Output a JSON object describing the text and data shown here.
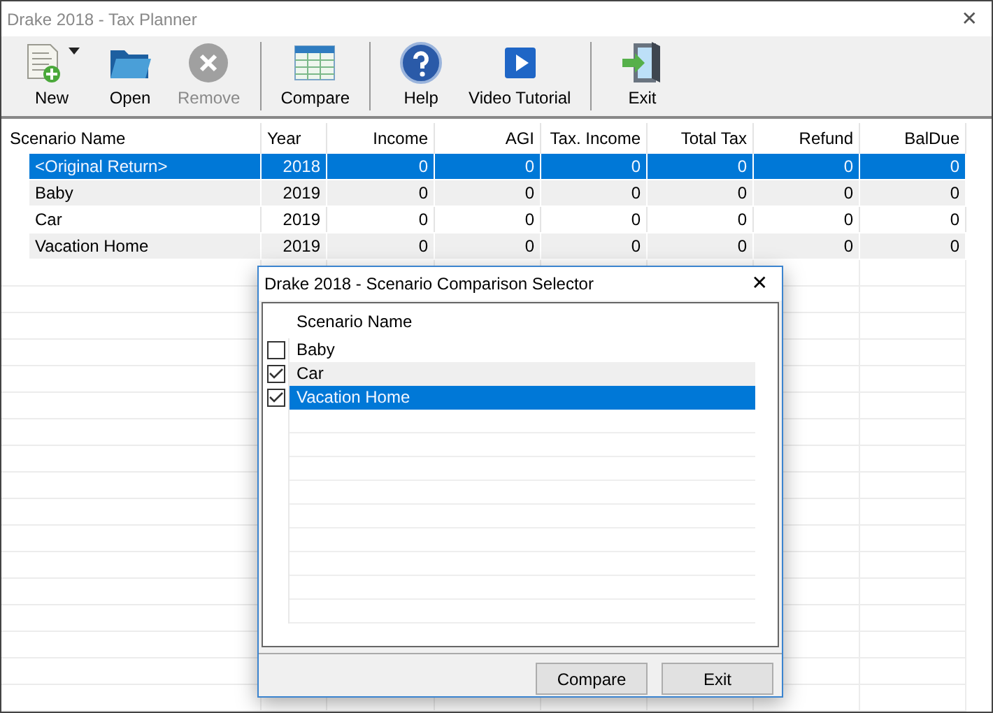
{
  "window": {
    "title": "Drake 2018 - Tax Planner",
    "close": "✕"
  },
  "toolbar": [
    {
      "kind": "new",
      "label": "New",
      "disabled": false,
      "dropdown": true,
      "group_end": false
    },
    {
      "kind": "open",
      "label": "Open",
      "disabled": false,
      "dropdown": false,
      "group_end": false
    },
    {
      "kind": "remove",
      "label": "Remove",
      "disabled": true,
      "dropdown": false,
      "group_end": true
    },
    {
      "kind": "compare",
      "label": "Compare",
      "disabled": false,
      "dropdown": false,
      "group_end": true
    },
    {
      "kind": "help",
      "label": "Help",
      "disabled": false,
      "dropdown": false,
      "group_end": false
    },
    {
      "kind": "video",
      "label": "Video Tutorial",
      "disabled": false,
      "dropdown": false,
      "group_end": true
    },
    {
      "kind": "exit",
      "label": "Exit",
      "disabled": false,
      "dropdown": false,
      "group_end": false
    }
  ],
  "table": {
    "columns": [
      "Scenario Name",
      "Year",
      "Income",
      "AGI",
      "Tax. Income",
      "Total Tax",
      "Refund",
      "BalDue"
    ],
    "rows": [
      {
        "cells": [
          "<Original Return>",
          "2018",
          "0",
          "0",
          "0",
          "0",
          "0",
          "0"
        ],
        "selected": true
      },
      {
        "cells": [
          "Baby",
          "2019",
          "0",
          "0",
          "0",
          "0",
          "0",
          "0"
        ],
        "selected": false
      },
      {
        "cells": [
          "Car",
          "2019",
          "0",
          "0",
          "0",
          "0",
          "0",
          "0"
        ],
        "selected": false
      },
      {
        "cells": [
          "Vacation Home",
          "2019",
          "0",
          "0",
          "0",
          "0",
          "0",
          "0"
        ],
        "selected": false
      }
    ]
  },
  "dialog": {
    "title": "Drake 2018 - Scenario Comparison Selector",
    "close": "✕",
    "column": "Scenario Name",
    "items": [
      {
        "name": "Baby",
        "checked": false,
        "selected": false
      },
      {
        "name": "Car",
        "checked": true,
        "selected": false
      },
      {
        "name": "Vacation Home",
        "checked": true,
        "selected": true
      }
    ],
    "buttons": [
      "Compare",
      "Exit"
    ]
  }
}
